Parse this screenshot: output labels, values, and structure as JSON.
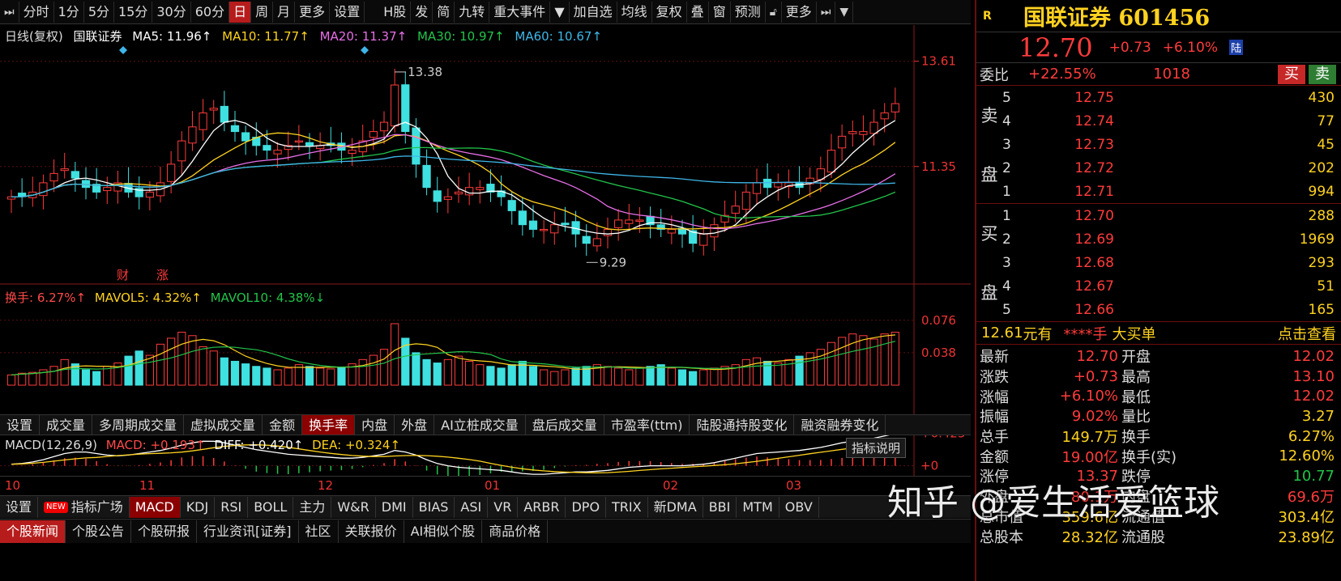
{
  "toolbar": {
    "items": [
      "分时",
      "1分",
      "5分",
      "15分",
      "30分",
      "60分",
      "日",
      "周",
      "月",
      "更多",
      "设置"
    ],
    "active": "日",
    "right_items": [
      "H股",
      "发",
      "简",
      "九转",
      "重大事件",
      "▼",
      "加自选",
      "均线",
      "复权",
      "叠",
      "窗",
      "预测",
      "更多"
    ]
  },
  "chart": {
    "ma_legend": {
      "label": "日线(复权)",
      "stock": "国联证券",
      "ma5": "MA5: 11.96↑",
      "ma10": "MA10: 11.77↑",
      "ma20": "MA20: 11.37↑",
      "ma30": "MA30: 10.97↑",
      "ma60": "MA60: 10.67↑"
    },
    "price_axis": {
      "high": "13.61",
      "mid": "11.35"
    },
    "annotations": {
      "high": "13.38",
      "low": "9.29",
      "cai": "财",
      "zhang": "涨"
    },
    "vol_legend": {
      "hs": "换手: 6.27%↑",
      "mavol5": "MAVOL5: 4.32%↑",
      "mavol10": "MAVOL10: 4.38%↓"
    },
    "vol_axis": {
      "high": "0.076",
      "mid": "0.038"
    },
    "macd_legend": {
      "name": "MACD(12,26,9)",
      "macd": "MACD: +0.193↑",
      "diff": "DIFF: +0.420↑",
      "dea": "DEA: +0.324↑"
    },
    "macd_axis": {
      "high": "+0.425",
      "zero": "+0"
    },
    "macd_help": "指标说明",
    "dates": [
      "10",
      "11",
      "12",
      "01",
      "02",
      "03"
    ]
  },
  "sub_tabs": [
    "设置",
    "成交量",
    "多周期成交量",
    "虚拟成交量",
    "金额",
    "换手率",
    "内盘",
    "外盘",
    "AI立桩成交量",
    "盘后成交量",
    "市盈率(ttm)",
    "陆股通持股变化",
    "融资融券变化"
  ],
  "sub_tab_active": "换手率",
  "indicator_tabs": [
    "设置",
    "指标广场",
    "MACD",
    "KDJ",
    "RSI",
    "BOLL",
    "主力",
    "W&R",
    "DMI",
    "BIAS",
    "ASI",
    "VR",
    "ARBR",
    "DPO",
    "TRIX",
    "新DMA",
    "BBI",
    "MTM",
    "OBV"
  ],
  "indicator_active": "MACD",
  "new_badge": "NEW",
  "news_tabs": [
    "个股新闻",
    "个股公告",
    "个股研报",
    "行业资讯[证券]",
    "社区",
    "关联报价",
    "AI相似个股",
    "商品价格"
  ],
  "news_active": "个股新闻",
  "panel": {
    "r": "R",
    "name": "国联证券 601456",
    "price": "12.70",
    "change": "+0.73",
    "change_pct": "+6.10%",
    "lu": "陆",
    "wb_label": "委比",
    "wb_pct": "+22.55%",
    "wb_num": "1018",
    "buy": "买",
    "sell": "卖",
    "sell_label_top": "卖",
    "sell_label_bottom": "盘",
    "buy_label_top": "买",
    "buy_label_bottom": "盘",
    "asks": [
      {
        "lvl": "5",
        "price": "12.75",
        "vol": "430"
      },
      {
        "lvl": "4",
        "price": "12.74",
        "vol": "77"
      },
      {
        "lvl": "3",
        "price": "12.73",
        "vol": "45"
      },
      {
        "lvl": "2",
        "price": "12.72",
        "vol": "202"
      },
      {
        "lvl": "1",
        "price": "12.71",
        "vol": "994"
      }
    ],
    "bids": [
      {
        "lvl": "1",
        "price": "12.70",
        "vol": "288"
      },
      {
        "lvl": "2",
        "price": "12.69",
        "vol": "1969"
      },
      {
        "lvl": "3",
        "price": "12.68",
        "vol": "293"
      },
      {
        "lvl": "4",
        "price": "12.67",
        "vol": "51"
      },
      {
        "lvl": "5",
        "price": "12.66",
        "vol": "165"
      }
    ],
    "bigorder": {
      "price": "12.61",
      "unit": "元有",
      "stars": "****手",
      "label": "大买单",
      "view": "点击查看"
    },
    "stats": [
      {
        "l1": "最新",
        "v1": "12.70",
        "l2": "开盘",
        "v2": "12.02"
      },
      {
        "l1": "涨跌",
        "v1": "+0.73",
        "l2": "最高",
        "v2": "13.10"
      },
      {
        "l1": "涨幅",
        "v1": "+6.10%",
        "l2": "最低",
        "v2": "12.02"
      },
      {
        "l1": "振幅",
        "v1": "9.02%",
        "l2": "量比",
        "v2": "3.27"
      },
      {
        "l1": "总手",
        "v1": "149.7万",
        "l2": "换手",
        "v2": "6.27%"
      },
      {
        "l1": "金额",
        "v1": "19.00亿",
        "l2": "换手(实)",
        "v2": "12.60%"
      },
      {
        "l1": "涨停",
        "v1": "13.37",
        "l2": "跌停",
        "v2": "10.77"
      },
      {
        "l1": "外盘",
        "v1": "80.1万",
        "l2": "内盘",
        "v2": "69.6万"
      },
      {
        "l1": "总市值",
        "v1": "359.6亿",
        "l2": "流通值",
        "v2": "303.4亿"
      },
      {
        "l1": "总股本",
        "v1": "28.32亿",
        "l2": "流通股",
        "v2": "23.89亿"
      }
    ]
  },
  "watermark": "知乎 @爱生活爱篮球",
  "chart_data": {
    "type": "candlestick",
    "series": [
      {
        "name": "MA5",
        "color": "#ffffff"
      },
      {
        "name": "MA10",
        "color": "#ffd21f"
      },
      {
        "name": "MA20",
        "color": "#e86ee8"
      },
      {
        "name": "MA30",
        "color": "#22c44a"
      },
      {
        "name": "MA60",
        "color": "#3fb6e8"
      }
    ],
    "price_ylim": [
      9.0,
      13.9
    ],
    "marked_high": 13.38,
    "marked_low": 9.29,
    "close_path": [
      10.7,
      10.7,
      10.8,
      11.0,
      11.2,
      11.3,
      11.1,
      10.9,
      10.8,
      10.9,
      11.0,
      10.8,
      10.7,
      10.8,
      11.0,
      11.4,
      11.9,
      12.2,
      12.5,
      12.6,
      12.3,
      12.1,
      11.9,
      11.8,
      11.7,
      11.7,
      11.8,
      11.9,
      11.8,
      11.8,
      11.8,
      11.7,
      11.7,
      11.9,
      12.1,
      12.3,
      13.1,
      12.1,
      11.4,
      10.9,
      10.6,
      10.7,
      10.8,
      10.9,
      10.9,
      10.8,
      10.7,
      10.4,
      10.1,
      10.0,
      10.0,
      10.1,
      10.1,
      9.9,
      9.7,
      9.8,
      10.0,
      10.2,
      10.2,
      10.2,
      10.1,
      10.0,
      10.0,
      9.9,
      9.7,
      9.9,
      10.1,
      10.3,
      10.5,
      10.8,
      11.0,
      10.9,
      11.0,
      11.0,
      10.9,
      11.1,
      11.3,
      11.7,
      12.0,
      12.1,
      12.1,
      12.3,
      12.5,
      12.7
    ],
    "turnover_ylim": [
      0,
      0.09
    ],
    "turnover": [
      0.012,
      0.014,
      0.015,
      0.018,
      0.022,
      0.03,
      0.025,
      0.018,
      0.016,
      0.022,
      0.026,
      0.034,
      0.04,
      0.035,
      0.048,
      0.055,
      0.062,
      0.058,
      0.045,
      0.04,
      0.032,
      0.028,
      0.025,
      0.022,
      0.02,
      0.018,
      0.02,
      0.024,
      0.022,
      0.02,
      0.019,
      0.021,
      0.025,
      0.03,
      0.035,
      0.042,
      0.072,
      0.055,
      0.038,
      0.03,
      0.026,
      0.03,
      0.034,
      0.028,
      0.024,
      0.022,
      0.02,
      0.024,
      0.028,
      0.022,
      0.018,
      0.016,
      0.018,
      0.02,
      0.022,
      0.024,
      0.022,
      0.02,
      0.018,
      0.02,
      0.022,
      0.024,
      0.02,
      0.018,
      0.016,
      0.018,
      0.02,
      0.022,
      0.024,
      0.03,
      0.032,
      0.028,
      0.026,
      0.03,
      0.034,
      0.038,
      0.042,
      0.05,
      0.056,
      0.06,
      0.058,
      0.054,
      0.06,
      0.062
    ],
    "macd_ylim": [
      -0.12,
      0.45
    ],
    "macd_diff": [
      0.02,
      0.03,
      0.05,
      0.08,
      0.12,
      0.16,
      0.18,
      0.18,
      0.16,
      0.14,
      0.13,
      0.14,
      0.16,
      0.18,
      0.2,
      0.23,
      0.27,
      0.3,
      0.32,
      0.32,
      0.3,
      0.27,
      0.24,
      0.21,
      0.19,
      0.17,
      0.15,
      0.14,
      0.13,
      0.12,
      0.11,
      0.1,
      0.1,
      0.11,
      0.13,
      0.15,
      0.2,
      0.18,
      0.14,
      0.08,
      0.03,
      0.0,
      -0.02,
      -0.03,
      -0.04,
      -0.05,
      -0.06,
      -0.08,
      -0.1,
      -0.11,
      -0.11,
      -0.1,
      -0.09,
      -0.08,
      -0.08,
      -0.07,
      -0.06,
      -0.04,
      -0.02,
      -0.01,
      0.0,
      0.0,
      0.0,
      0.0,
      0.01,
      0.02,
      0.04,
      0.07,
      0.1,
      0.13,
      0.16,
      0.17,
      0.18,
      0.19,
      0.2,
      0.22,
      0.24,
      0.27,
      0.3,
      0.32,
      0.34,
      0.36,
      0.39,
      0.42
    ]
  }
}
